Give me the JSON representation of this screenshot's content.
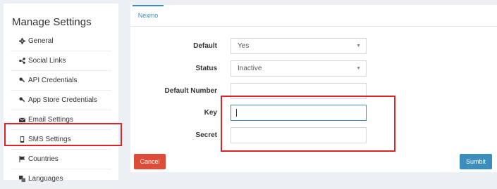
{
  "sidebar": {
    "title": "Manage Settings",
    "items": [
      {
        "label": "General",
        "icon": "gear-icon"
      },
      {
        "label": "Social Links",
        "icon": "share-icon"
      },
      {
        "label": "API Credentials",
        "icon": "key-icon"
      },
      {
        "label": "App Store Credentials",
        "icon": "key-icon"
      },
      {
        "label": "Email Settings",
        "icon": "envelope-icon"
      },
      {
        "label": "SMS Settings",
        "icon": "mobile-icon"
      },
      {
        "label": "Countries",
        "icon": "flag-icon"
      },
      {
        "label": "Languages",
        "icon": "language-icon"
      }
    ]
  },
  "tabs": [
    {
      "label": "Nexmo",
      "active": true
    }
  ],
  "form": {
    "default_label": "Default",
    "default_value": "Yes",
    "status_label": "Status",
    "status_value": "Inactive",
    "default_number_label": "Default Number",
    "default_number_value": "",
    "key_label": "Key",
    "key_value": "",
    "secret_label": "Secret",
    "secret_value": ""
  },
  "buttons": {
    "cancel": "Cancel",
    "submit": "Sumbit"
  },
  "colors": {
    "accent": "#3c8dbc",
    "danger": "#dd4b39",
    "annotation": "#d9252a",
    "background": "#ecf0f5"
  }
}
